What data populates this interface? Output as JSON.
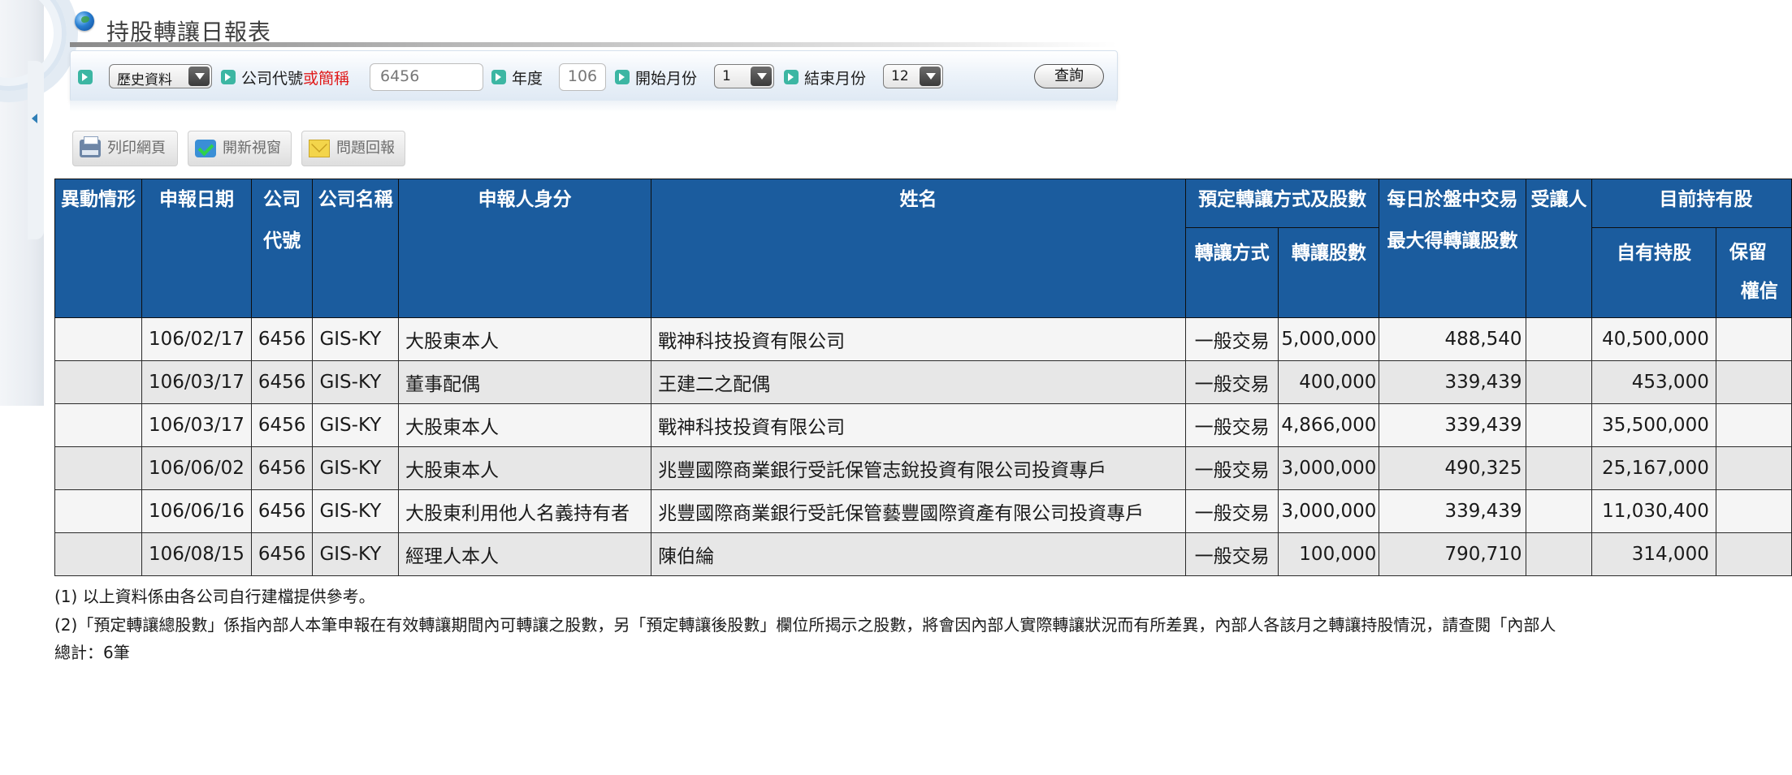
{
  "title": "持股轉讓日報表",
  "search": {
    "mode_selected": "歷史資料",
    "company_label_prefix": "公司代號",
    "company_label_red": "或簡稱",
    "company_value": "6456",
    "year_label": "年度",
    "year_value": "106",
    "start_month_label": "開始月份",
    "start_month_value": "1",
    "end_month_label": "結束月份",
    "end_month_value": "12",
    "query_label": "查詢"
  },
  "toolbar": {
    "print_label": "列印網頁",
    "new_window_label": "開新視窗",
    "report_label": "問題回報"
  },
  "table": {
    "headers": {
      "change": "異動情形",
      "date": "申報日期",
      "code_line1": "公司",
      "code_line2": "代號",
      "company_name": "公司名稱",
      "identity": "申報人身分",
      "name": "姓名",
      "planned_group": "預定轉讓方式及股數",
      "method": "轉讓方式",
      "shares": "轉讓股數",
      "daily_line1": "每日於盤中交易",
      "daily_line2": "最大得轉讓股數",
      "transferee": "受讓人",
      "current_group": "目前持有股",
      "own_holding": "自有持股",
      "reserved_line1": "保留",
      "reserved_line2": "權信"
    },
    "rows": [
      {
        "change": "",
        "date": "106/02/17",
        "code": "6456",
        "company": "GIS-KY",
        "identity": "大股東本人",
        "name": "戰神科技投資有限公司",
        "method": "一般交易",
        "shares": "5,000,000",
        "daily_max": "488,540",
        "transferee": "",
        "own_holding": "40,500,000",
        "reserved": ""
      },
      {
        "change": "",
        "date": "106/03/17",
        "code": "6456",
        "company": "GIS-KY",
        "identity": "董事配偶",
        "name": "王建二之配偶",
        "method": "一般交易",
        "shares": "400,000",
        "daily_max": "339,439",
        "transferee": "",
        "own_holding": "453,000",
        "reserved": ""
      },
      {
        "change": "",
        "date": "106/03/17",
        "code": "6456",
        "company": "GIS-KY",
        "identity": "大股東本人",
        "name": "戰神科技投資有限公司",
        "method": "一般交易",
        "shares": "4,866,000",
        "daily_max": "339,439",
        "transferee": "",
        "own_holding": "35,500,000",
        "reserved": ""
      },
      {
        "change": "",
        "date": "106/06/02",
        "code": "6456",
        "company": "GIS-KY",
        "identity": "大股東本人",
        "name": "兆豐國際商業銀行受託保管志銳投資有限公司投資專戶",
        "method": "一般交易",
        "shares": "3,000,000",
        "daily_max": "490,325",
        "transferee": "",
        "own_holding": "25,167,000",
        "reserved": ""
      },
      {
        "change": "",
        "date": "106/06/16",
        "code": "6456",
        "company": "GIS-KY",
        "identity": "大股東利用他人名義持有者",
        "name": "兆豐國際商業銀行受託保管藝豐國際資產有限公司投資專戶",
        "method": "一般交易",
        "shares": "3,000,000",
        "daily_max": "339,439",
        "transferee": "",
        "own_holding": "11,030,400",
        "reserved": ""
      },
      {
        "change": "",
        "date": "106/08/15",
        "code": "6456",
        "company": "GIS-KY",
        "identity": "經理人本人",
        "name": "陳伯綸",
        "method": "一般交易",
        "shares": "100,000",
        "daily_max": "790,710",
        "transferee": "",
        "own_holding": "314,000",
        "reserved": ""
      }
    ]
  },
  "notes": {
    "note1": "(1) 以上資料係由各公司自行建檔提供參考。",
    "note2": "(2)「預定轉讓總股數」係指內部人本筆申報在有效轉讓期間內可轉讓之股數，另「預定轉讓後股數」欄位所揭示之股數，將會因內部人實際轉讓狀況而有所差異，內部人各該月之轉讓持股情況，請查閱「內部人",
    "total": "總計：6筆"
  }
}
